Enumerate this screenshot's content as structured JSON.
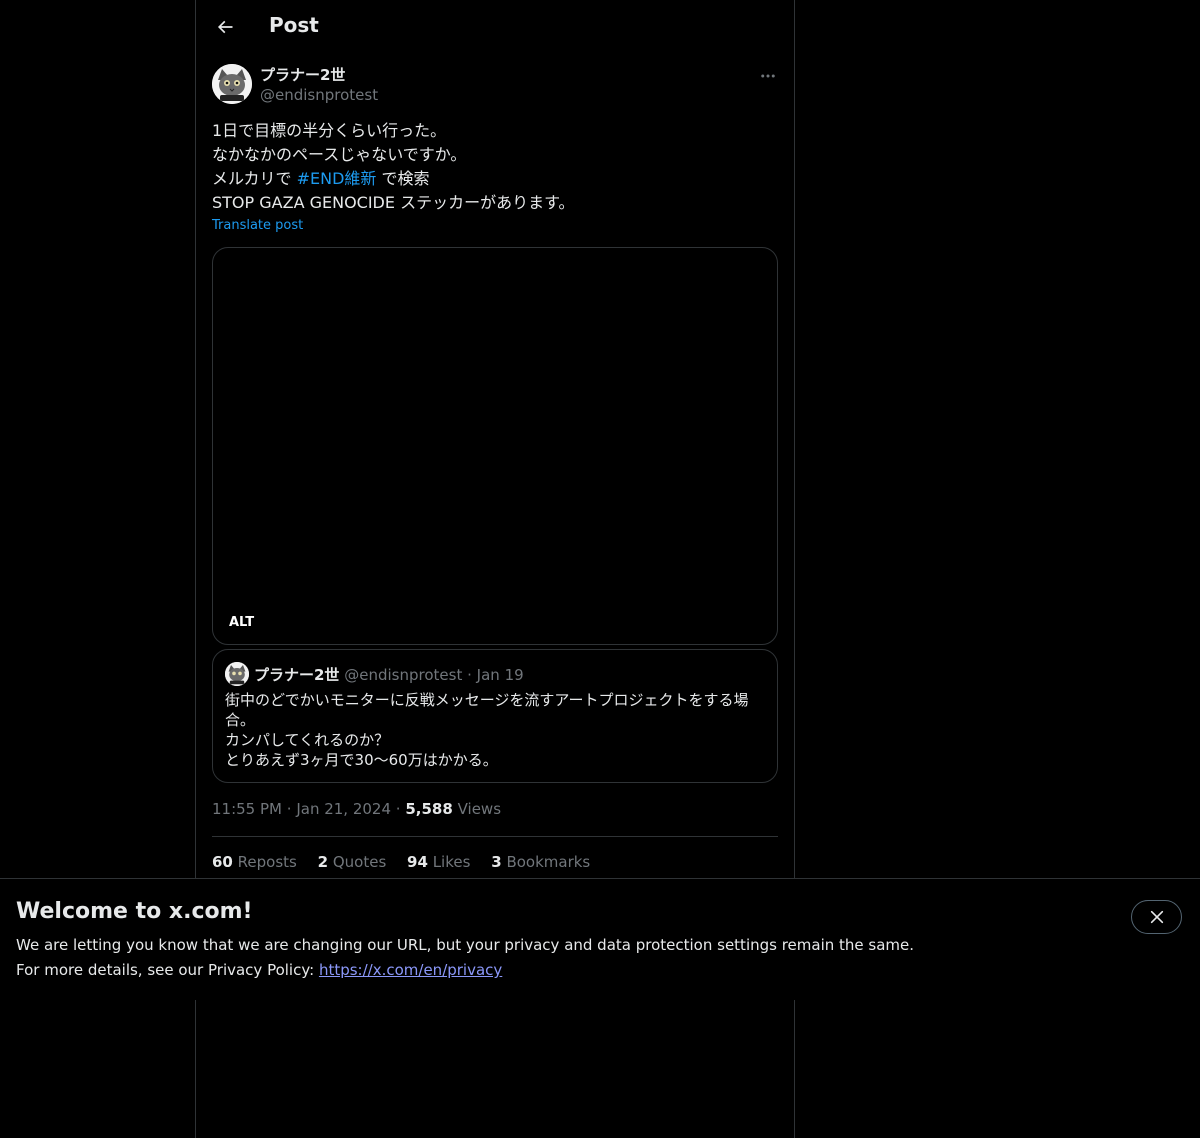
{
  "header": {
    "title": "Post"
  },
  "post": {
    "author_name": "プラナー2世",
    "author_handle": "@endisnprotest",
    "text": {
      "line1": "1日で目標の半分くらい行った。",
      "line2": "なかなかのペースじゃないですか。",
      "line3_pre": "メルカリで ",
      "hashtag": "#END維新",
      "line3_post": " で検索",
      "line4": "STOP GAZA GENOCIDE ステッカーがあります。"
    },
    "translate_label": "Translate post",
    "media_alt_badge": "ALT",
    "time": "11:55 PM",
    "date": "Jan 21, 2024",
    "separator": "·",
    "views_count": "5,588",
    "views_label": "Views"
  },
  "quote": {
    "author_name": "プラナー2世",
    "author_handle": "@endisnprotest",
    "separator": "·",
    "date": "Jan 19",
    "lines": [
      "街中のどでかいモニターに反戦メッセージを流すアートプロジェクトをする場合。",
      "カンパしてくれるのか？",
      "とりあえず3ヶ月で30〜60万はかかる。"
    ]
  },
  "stats": {
    "reposts": {
      "count": "60",
      "label": "Reposts"
    },
    "quotes": {
      "count": "2",
      "label": "Quotes"
    },
    "likes": {
      "count": "94",
      "label": "Likes"
    },
    "bookmarks": {
      "count": "3",
      "label": "Bookmarks"
    }
  },
  "banner": {
    "title": "Welcome to x.com!",
    "line1": "We are letting you know that we are changing our URL, but your privacy and data protection settings remain the same.",
    "line2_prefix": "For more details, see our Privacy Policy: ",
    "link": "https://x.com/en/privacy"
  },
  "icons": {
    "back": "arrow-left-icon",
    "more": "more-horizontal-icon",
    "close": "close-icon"
  },
  "colors": {
    "background": "#000000",
    "text": "#e7e9ea",
    "muted": "#71767b",
    "accent": "#1d9bf0",
    "border": "#2f3336",
    "link": "#8b98f9"
  }
}
